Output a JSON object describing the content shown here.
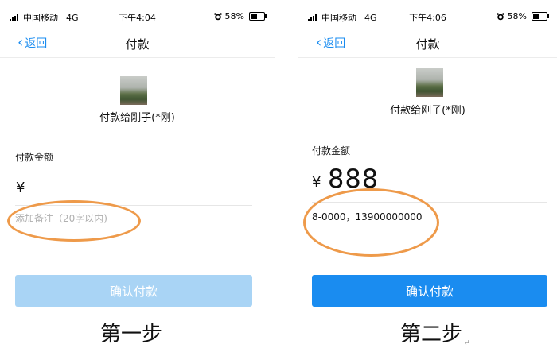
{
  "status": {
    "carrier": "中国移动",
    "network": "4G",
    "battery": "58%",
    "battery_level": 0.58,
    "alarm_icon": "alarm-clock-icon"
  },
  "step1": {
    "time": "下午4:04",
    "back_label": "返回",
    "title": "付款",
    "payee": "付款给刚子(*刚)",
    "amount_label": "付款金额",
    "currency": "¥",
    "note_placeholder": "添加备注（20字以内)",
    "confirm_label": "确认付款",
    "confirm_color": "#a9d4f5",
    "caption": "第一步"
  },
  "step2": {
    "time": "下午4:06",
    "back_label": "返回",
    "title": "付款",
    "payee": "付款给刚子(*刚)",
    "amount_label": "付款金额",
    "currency": "¥",
    "amount": "888",
    "note_value": "8-0000，13900000000",
    "confirm_label": "确认付款",
    "confirm_color": "#1a8cf0",
    "caption": "第二步",
    "caption_mark": "↵"
  },
  "colors": {
    "accent": "#1a8cf0",
    "highlight": "#ee9a4a"
  }
}
